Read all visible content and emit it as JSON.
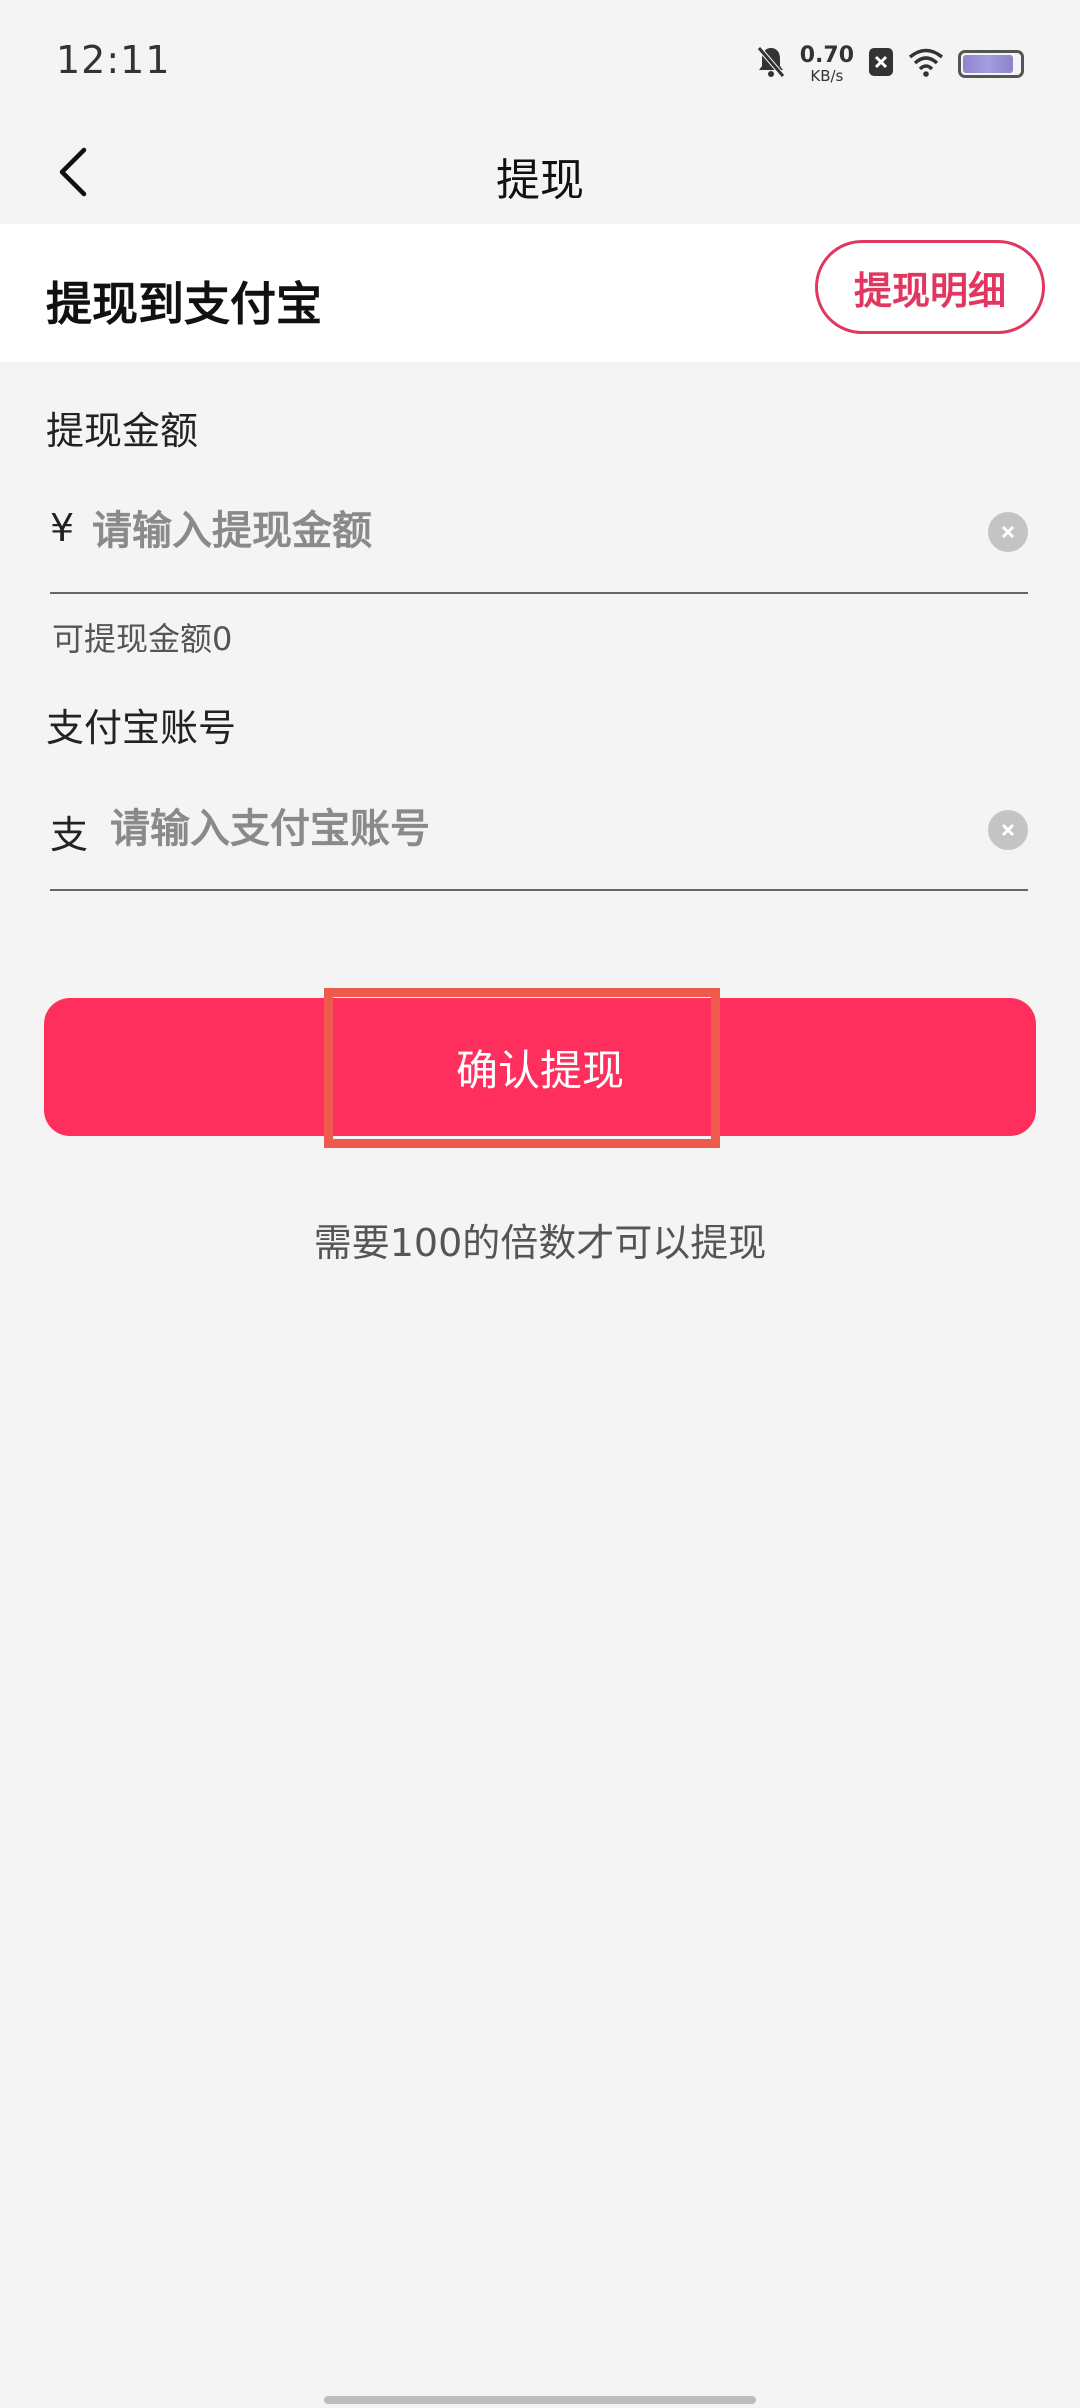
{
  "status_bar": {
    "time": "12:11",
    "net_speed_value": "0.70",
    "net_speed_unit": "KB/s",
    "icons": [
      "bell-muted-icon",
      "close-box-icon",
      "wifi-icon",
      "battery-icon"
    ],
    "battery_level": 0.9
  },
  "nav": {
    "title": "提现",
    "back_icon": "chevron-left-icon"
  },
  "header": {
    "title": "提现到支付宝",
    "detail_button": "提现明细"
  },
  "amount": {
    "label": "提现金额",
    "prefix": "¥",
    "placeholder": "请输入提现金额",
    "value": "",
    "available": "可提现金额0"
  },
  "account": {
    "label": "支付宝账号",
    "prefix": "支",
    "placeholder": "请输入支付宝账号",
    "value": ""
  },
  "confirm_button": "确认提现",
  "note": "需要100的倍数才可以提现",
  "colors": {
    "accent": "#ff2f5d",
    "outline_accent": "#e0365f",
    "highlight": "#ee5a4e",
    "background": "#f5f4f5"
  }
}
